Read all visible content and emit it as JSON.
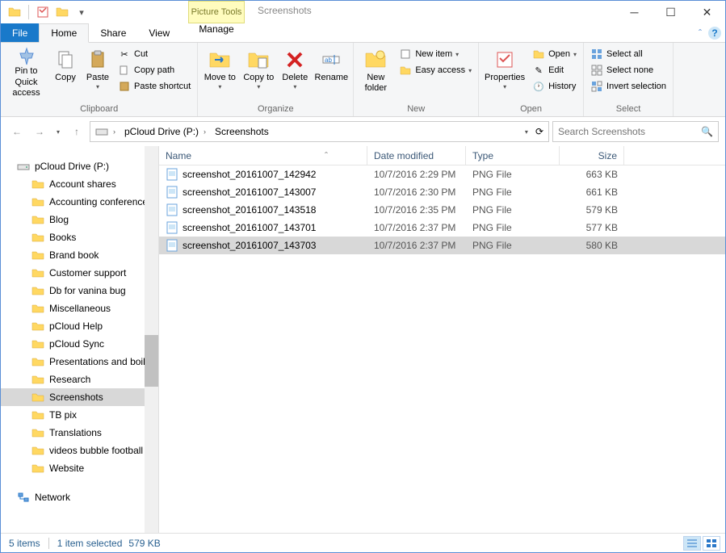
{
  "window": {
    "contextual_tab": "Picture Tools",
    "title": "Screenshots"
  },
  "tabs": {
    "file": "File",
    "home": "Home",
    "share": "Share",
    "view": "View",
    "manage": "Manage"
  },
  "ribbon": {
    "clipboard": {
      "pin": "Pin to Quick access",
      "copy": "Copy",
      "paste": "Paste",
      "cut": "Cut",
      "copy_path": "Copy path",
      "paste_shortcut": "Paste shortcut",
      "label": "Clipboard"
    },
    "organize": {
      "move_to": "Move to",
      "copy_to": "Copy to",
      "delete": "Delete",
      "rename": "Rename",
      "label": "Organize"
    },
    "new": {
      "new_folder": "New folder",
      "new_item": "New item",
      "easy_access": "Easy access",
      "label": "New"
    },
    "open": {
      "properties": "Properties",
      "open": "Open",
      "edit": "Edit",
      "history": "History",
      "label": "Open"
    },
    "select": {
      "select_all": "Select all",
      "select_none": "Select none",
      "invert": "Invert selection",
      "label": "Select"
    }
  },
  "breadcrumb": {
    "root": "pCloud Drive (P:)",
    "current": "Screenshots"
  },
  "search": {
    "placeholder": "Search Screenshots"
  },
  "sidebar": {
    "drive": "pCloud Drive (P:)",
    "folders": [
      "Account shares",
      "Accounting conferences",
      "Blog",
      "Books",
      "Brand book",
      "Customer support",
      "Db for vanina bug",
      "Miscellaneous",
      "pCloud Help",
      "pCloud Sync",
      "Presentations and boilerplates",
      "Research",
      "Screenshots",
      "TB pix",
      "Translations",
      "videos bubble football",
      "Website"
    ],
    "network": "Network"
  },
  "columns": {
    "name": "Name",
    "date": "Date modified",
    "type": "Type",
    "size": "Size"
  },
  "files": [
    {
      "name": "screenshot_20161007_142942",
      "date": "10/7/2016 2:29 PM",
      "type": "PNG File",
      "size": "663 KB"
    },
    {
      "name": "screenshot_20161007_143007",
      "date": "10/7/2016 2:30 PM",
      "type": "PNG File",
      "size": "661 KB"
    },
    {
      "name": "screenshot_20161007_143518",
      "date": "10/7/2016 2:35 PM",
      "type": "PNG File",
      "size": "579 KB"
    },
    {
      "name": "screenshot_20161007_143701",
      "date": "10/7/2016 2:37 PM",
      "type": "PNG File",
      "size": "577 KB"
    },
    {
      "name": "screenshot_20161007_143703",
      "date": "10/7/2016 2:37 PM",
      "type": "PNG File",
      "size": "580 KB"
    }
  ],
  "selected_file_index": 4,
  "selected_folder_index": 12,
  "status": {
    "count": "5 items",
    "selection": "1 item selected",
    "size": "579 KB"
  }
}
